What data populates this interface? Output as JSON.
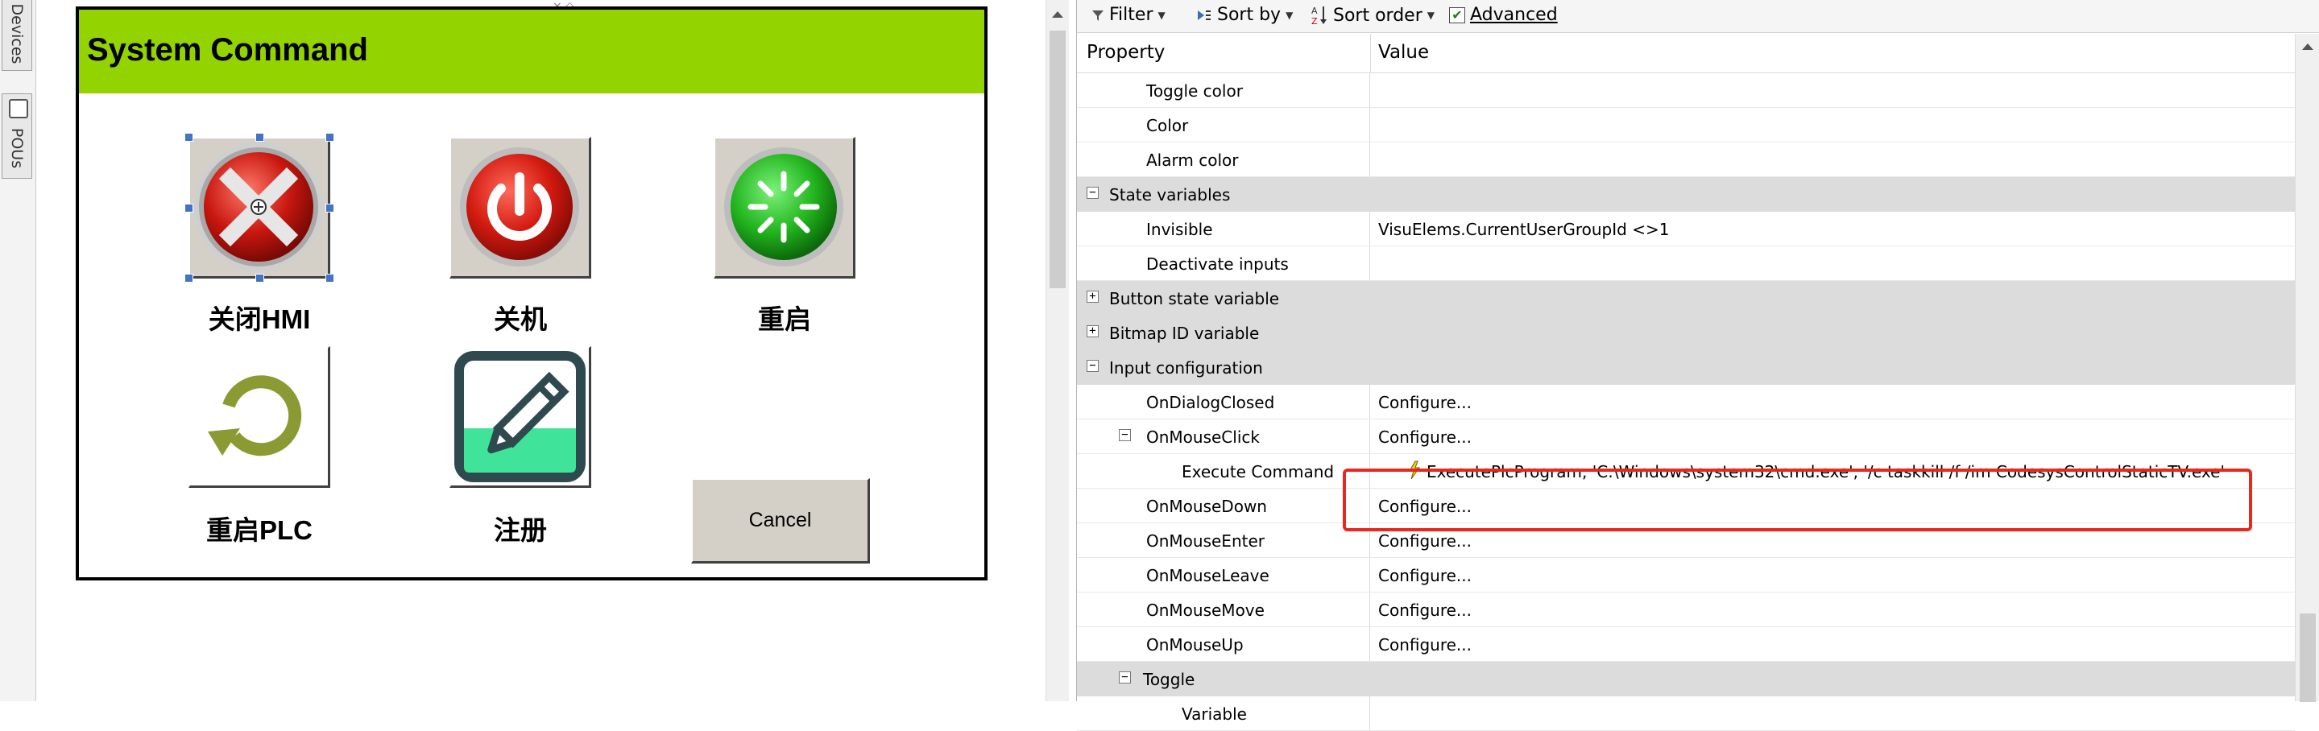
{
  "side_tabs": {
    "devices": "Devices",
    "pous": "POUs"
  },
  "dialog": {
    "title": "System Command",
    "buttons": [
      {
        "caption": "关闭HMI",
        "icon": "close-x-icon"
      },
      {
        "caption": "关机",
        "icon": "power-icon"
      },
      {
        "caption": "重启",
        "icon": "restart-sun-icon"
      },
      {
        "caption": "重启PLC",
        "icon": "circular-arrow-icon"
      },
      {
        "caption": "注册",
        "icon": "pencil-edit-icon"
      }
    ],
    "cancel_label": "Cancel"
  },
  "toolbar": {
    "filter": "Filter",
    "sort_by": "Sort by",
    "sort_order": "Sort order",
    "advanced": "Advanced",
    "advanced_checked": true
  },
  "grid": {
    "header_property": "Property",
    "header_value": "Value",
    "rows": [
      {
        "label": "Toggle color",
        "value": "",
        "level": 2
      },
      {
        "label": "Color",
        "value": "",
        "level": 2
      },
      {
        "label": "Alarm color",
        "value": "",
        "level": 2
      },
      {
        "label": "State variables",
        "value": "",
        "level": 1,
        "category": true,
        "expander": "−"
      },
      {
        "label": "Invisible",
        "value": "VisuElems.CurrentUserGroupId <>1",
        "level": 2
      },
      {
        "label": "Deactivate inputs",
        "value": "",
        "level": 2
      },
      {
        "label": "Button state variable",
        "value": "",
        "level": 1,
        "category": true,
        "expander": "+"
      },
      {
        "label": "Bitmap ID variable",
        "value": "",
        "level": 1,
        "category": true,
        "expander": "+"
      },
      {
        "label": "Input configuration",
        "value": "",
        "level": 1,
        "category": true,
        "expander": "−"
      },
      {
        "label": "OnDialogClosed",
        "value": "Configure...",
        "level": 2
      },
      {
        "label": "OnMouseClick",
        "value": "Configure...",
        "level": 2,
        "expander": "−"
      },
      {
        "label": "Execute Command",
        "value": "ExecutePlcProgram, 'C:\\Windows\\system32\\cmd.exe', '/c taskkill /f /im CodesysControlStaticTV.exe'",
        "level": 3,
        "exec": true
      },
      {
        "label": "OnMouseDown",
        "value": "Configure...",
        "level": 2
      },
      {
        "label": "OnMouseEnter",
        "value": "Configure...",
        "level": 2
      },
      {
        "label": "OnMouseLeave",
        "value": "Configure...",
        "level": 2
      },
      {
        "label": "OnMouseMove",
        "value": "Configure...",
        "level": 2
      },
      {
        "label": "OnMouseUp",
        "value": "Configure...",
        "level": 2
      },
      {
        "label": "Toggle",
        "value": "",
        "level": 2,
        "category": true,
        "expander": "−"
      },
      {
        "label": "Variable",
        "value": "",
        "level": 3
      }
    ]
  },
  "colors": {
    "header_green": "#93d400",
    "highlight_red": "#e8281e",
    "category_gray": "#dcdcdc"
  }
}
